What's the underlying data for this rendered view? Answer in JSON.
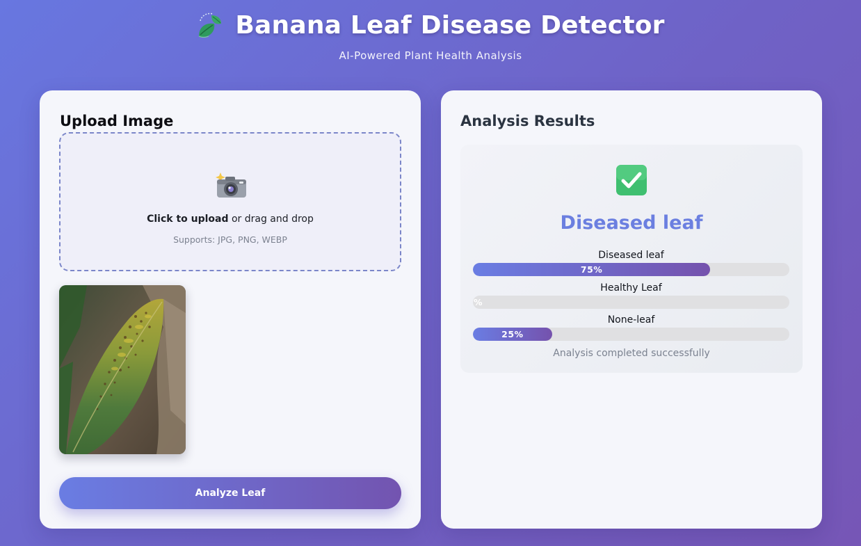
{
  "header": {
    "title": "Banana Leaf Disease Detector",
    "subtitle": "AI-Powered Plant Health Analysis",
    "logo_icon": "leaf-icon"
  },
  "upload": {
    "title": "Upload Image",
    "icon": "camera-icon",
    "click_text": "Click to upload",
    "drag_text": " or drag and drop",
    "supports_text": "Supports: JPG, PNG, WEBP",
    "preview_alt": "banana-leaf-photo",
    "analyze_label": "Analyze Leaf"
  },
  "results": {
    "title": "Analysis Results",
    "status_icon": "check-icon",
    "prediction": "Diseased leaf",
    "bars": [
      {
        "label": "Diseased leaf",
        "percent": 75,
        "percent_label": "75%"
      },
      {
        "label": "Healthy Leaf",
        "percent": 0,
        "percent_label": "%"
      },
      {
        "label": "None-leaf",
        "percent": 25,
        "percent_label": "25%"
      }
    ],
    "status_text": "Analysis completed successfully"
  },
  "colors": {
    "accent": "#6b7fe0",
    "accent_end": "#7552ad",
    "success": "#4cc97a"
  }
}
